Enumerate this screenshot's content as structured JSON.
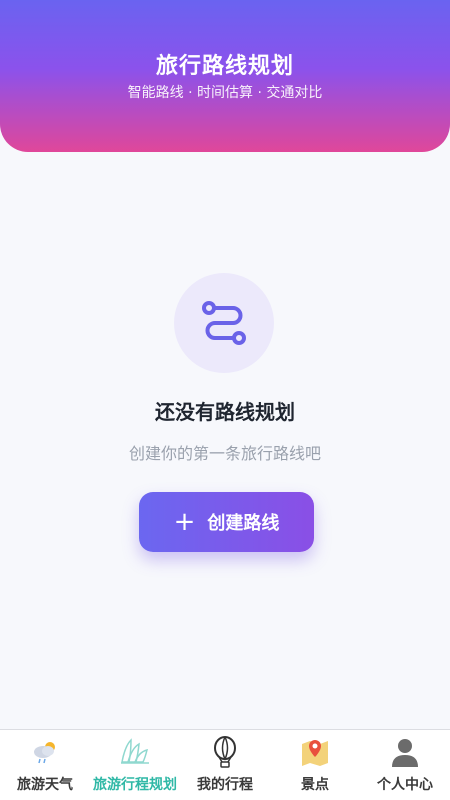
{
  "header": {
    "title": "旅行路线规划",
    "subtitle": "智能路线 · 时间估算 · 交通对比"
  },
  "empty_state": {
    "icon": "route-icon",
    "title": "还没有路线规划",
    "description": "创建你的第一条旅行路线吧",
    "button_icon": "plus-icon",
    "button_plus": "+",
    "button_label": "创建路线"
  },
  "tabbar": {
    "active": "旅游行程规划",
    "items": [
      {
        "label": "旅游天气",
        "icon": "weather-icon"
      },
      {
        "label": "旅游行程规划",
        "icon": "sydney-opera-icon"
      },
      {
        "label": "我的行程",
        "icon": "hot-air-balloon-icon"
      },
      {
        "label": "景点",
        "icon": "map-pin-icon"
      },
      {
        "label": "个人中心",
        "icon": "user-icon"
      }
    ]
  },
  "colors": {
    "accent": "#7a5cf0",
    "header_gradient_top": "#6a63f0",
    "header_gradient_bottom": "#e0479a",
    "active_tab": "#2fb8a6"
  }
}
